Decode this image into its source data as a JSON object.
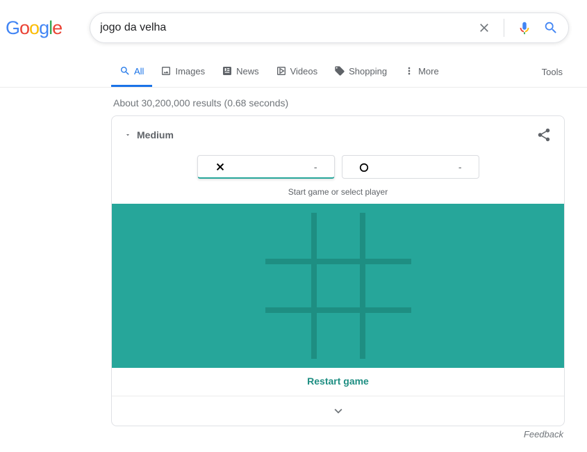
{
  "logo": {
    "g1": "G",
    "o1": "o",
    "o2": "o",
    "g2": "g",
    "l": "l",
    "e": "e"
  },
  "search": {
    "query": "jogo da velha"
  },
  "tabs": [
    "All",
    "Images",
    "News",
    "Videos",
    "Shopping",
    "More"
  ],
  "tools_label": "Tools",
  "results_info": "About 30,200,000 results (0.68 seconds)",
  "game": {
    "difficulty": "Medium",
    "instruction": "Start game or select player",
    "players": [
      {
        "symbol": "✕",
        "score": "-"
      },
      {
        "symbol": "O",
        "score": "-"
      }
    ],
    "restart_label": "Restart game"
  },
  "feedback_label": "Feedback"
}
